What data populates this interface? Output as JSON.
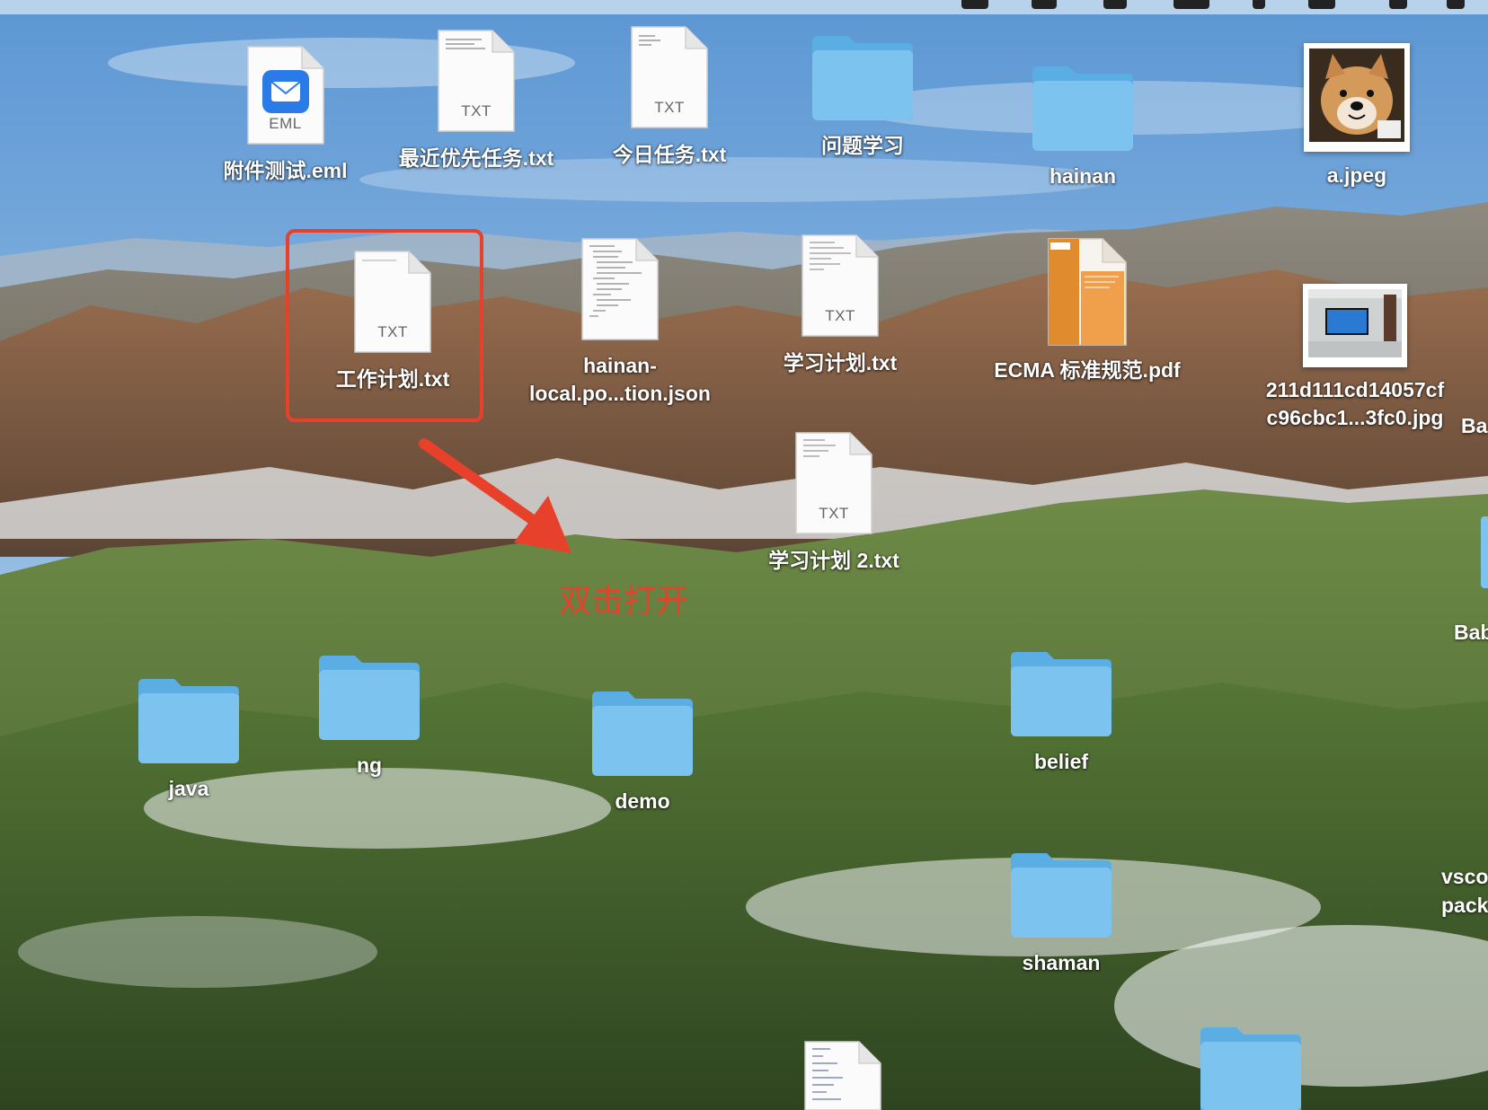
{
  "colors": {
    "selection": "#e8412b",
    "annotation": "#e8412b",
    "folder_blue": "#7cc4ef"
  },
  "annotation_text": "双击打开",
  "desktop": {
    "items": [
      {
        "id": "email",
        "label": "附件测试.eml",
        "ext": "EML",
        "kind": "email-document"
      },
      {
        "id": "recent",
        "label": "最近优先任务.txt",
        "ext": "TXT",
        "kind": "text-document"
      },
      {
        "id": "today",
        "label": "今日任务.txt",
        "ext": "TXT",
        "kind": "text-document"
      },
      {
        "id": "wenti",
        "label": "问题学习",
        "kind": "folder"
      },
      {
        "id": "hainan",
        "label": "hainan",
        "kind": "folder"
      },
      {
        "id": "ajpeg",
        "label": "a.jpeg",
        "kind": "image"
      },
      {
        "id": "work",
        "label": "工作计划.txt",
        "ext": "TXT",
        "kind": "text-document",
        "selected": true
      },
      {
        "id": "hjson",
        "label_line1": "hainan-",
        "label_line2": "local.po...tion.json",
        "kind": "text-document"
      },
      {
        "id": "study",
        "label": "学习计划.txt",
        "ext": "TXT",
        "kind": "text-document"
      },
      {
        "id": "ecma",
        "label": "ECMA 标准规范.pdf",
        "kind": "pdf"
      },
      {
        "id": "jpg211",
        "label_line1": "211d111cd14057cf",
        "label_line2": "c96cbc1...3fc0.jpg",
        "kind": "image"
      },
      {
        "id": "study2",
        "label": "学习计划 2.txt",
        "ext": "TXT",
        "kind": "text-document"
      },
      {
        "id": "java",
        "label": "java",
        "kind": "folder"
      },
      {
        "id": "ng",
        "label": "ng",
        "kind": "folder"
      },
      {
        "id": "demo",
        "label": "demo",
        "kind": "folder"
      },
      {
        "id": "belief",
        "label": "belief",
        "kind": "folder"
      },
      {
        "id": "shaman",
        "label": "shaman",
        "kind": "folder"
      }
    ],
    "partial_labels": {
      "ba": "Ba",
      "bab": "Bab",
      "vsco": "vsco",
      "pack": "pack"
    }
  }
}
